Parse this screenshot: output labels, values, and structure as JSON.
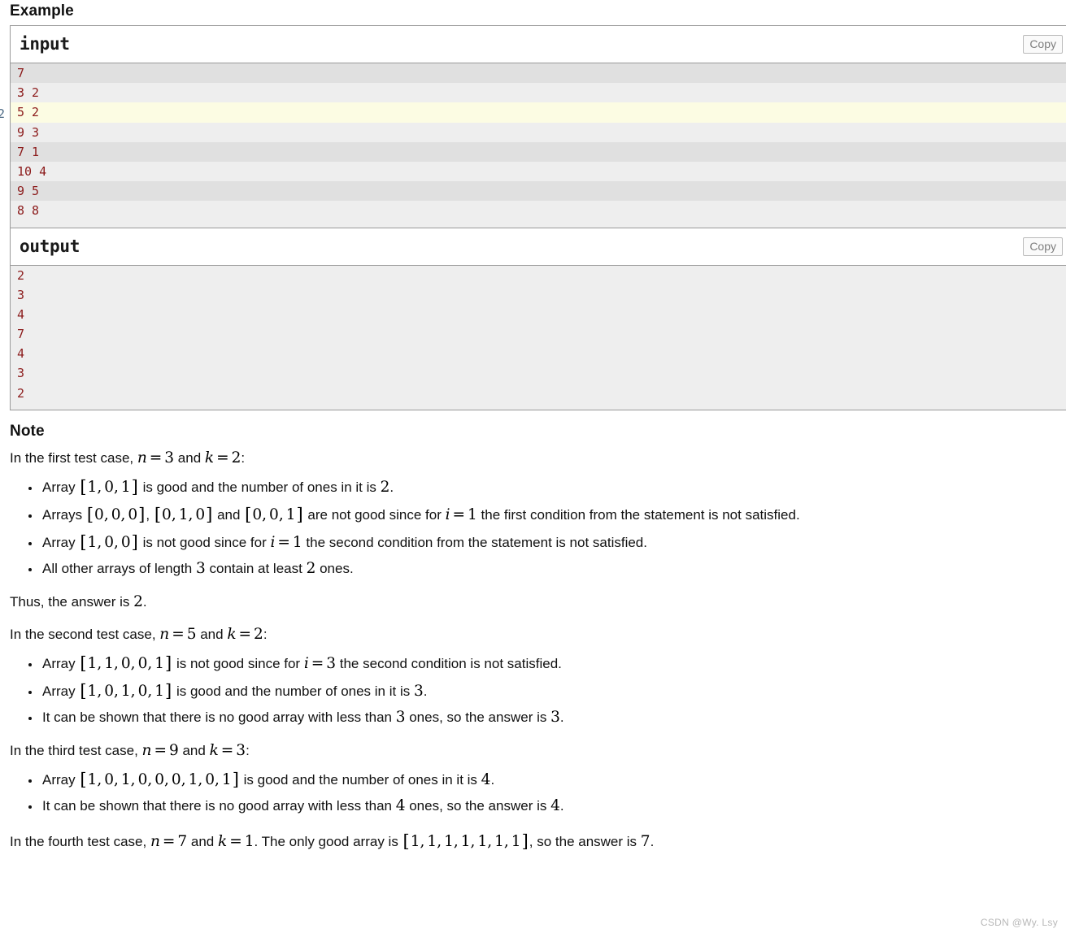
{
  "example": {
    "heading": "Example",
    "input_block": {
      "title": "input",
      "copy_label": "Copy",
      "lines": [
        "7",
        "3 2",
        "5 2",
        "9 3",
        "7 1",
        "10 4",
        "9 5",
        "8 8"
      ],
      "highlighted_line_index": 2
    },
    "output_block": {
      "title": "output",
      "copy_label": "Copy",
      "lines": [
        "2",
        "3",
        "4",
        "7",
        "4",
        "3",
        "2"
      ]
    },
    "edge_artifact_glyph": "2"
  },
  "note": {
    "heading": "Note",
    "case1": {
      "intro_pre": "In the first test case, ",
      "intro_n": {
        "var": "n",
        "op": "=",
        "num": "3"
      },
      "intro_mid": " and ",
      "intro_k": {
        "var": "k",
        "op": "=",
        "num": "2"
      },
      "intro_post": ":",
      "bullets": [
        {
          "pre": "Array ",
          "array": "[ 1, 0, 1 ]",
          "post": " is good and the number of ones in it is ",
          "tail_num": "2",
          "tail": "."
        },
        {
          "pre": "Arrays ",
          "array": "[ 0, 0, 0 ]",
          "mid1": ", ",
          "array2": "[ 0, 1, 0 ]",
          "mid2": " and ",
          "array3": "[ 0, 0, 1 ]",
          "post": " are not good since for ",
          "cond_var": "i",
          "cond_op": "=",
          "cond_num": "1",
          "tail": " the first condition from the statement is not satisfied."
        },
        {
          "pre": "Array ",
          "array": "[ 1, 0, 0 ]",
          "post": " is not good since for ",
          "cond_var": "i",
          "cond_op": "=",
          "cond_num": "1",
          "tail": " the second condition from the statement is not satisfied."
        },
        {
          "pre": "All other arrays of length ",
          "num1": "3",
          "mid": " contain at least ",
          "num2": "2",
          "tail": " ones."
        }
      ],
      "conclusion_pre": "Thus, the answer is ",
      "conclusion_num": "2",
      "conclusion_post": "."
    },
    "case2": {
      "intro_pre": "In the second test case, ",
      "intro_n": {
        "var": "n",
        "op": "=",
        "num": "5"
      },
      "intro_mid": " and ",
      "intro_k": {
        "var": "k",
        "op": "=",
        "num": "2"
      },
      "intro_post": ":",
      "bullets": [
        {
          "pre": "Array ",
          "array": "[ 1, 1, 0, 0, 1 ]",
          "post": " is not good since for ",
          "cond_var": "i",
          "cond_op": "=",
          "cond_num": "3",
          "tail": " the second condition is not satisfied."
        },
        {
          "pre": "Array ",
          "array": "[ 1, 0, 1, 0, 1 ]",
          "post": " is good and the number of ones in it is ",
          "tail_num": "3",
          "tail": "."
        },
        {
          "pre": "It can be shown that there is no good array with less than ",
          "num1": "3",
          "mid": " ones, so the answer is ",
          "num2": "3",
          "tail": "."
        }
      ]
    },
    "case3": {
      "intro_pre": "In the third test case, ",
      "intro_n": {
        "var": "n",
        "op": "=",
        "num": "9"
      },
      "intro_mid": " and ",
      "intro_k": {
        "var": "k",
        "op": "=",
        "num": "3"
      },
      "intro_post": ":",
      "bullets": [
        {
          "pre": "Array ",
          "array": "[ 1, 0, 1, 0, 0, 0, 1, 0, 1 ]",
          "post": " is good and the number of ones in it is ",
          "tail_num": "4",
          "tail": "."
        },
        {
          "pre": "It can be shown that there is no good array with less than ",
          "num1": "4",
          "mid": " ones, so the answer is ",
          "num2": "4",
          "tail": "."
        }
      ]
    },
    "case4": {
      "intro_pre": "In the fourth test case, ",
      "intro_n": {
        "var": "n",
        "op": "=",
        "num": "7"
      },
      "intro_mid": " and ",
      "intro_k": {
        "var": "k",
        "op": "=",
        "num": "1"
      },
      "intro_post": ". The only good array is ",
      "array": "[ 1, 1, 1, 1, 1, 1, 1 ]",
      "tail_pre": ", so the answer is ",
      "tail_num": "7",
      "tail_post": "."
    }
  },
  "watermark": "CSDN @Wy. Lsy"
}
